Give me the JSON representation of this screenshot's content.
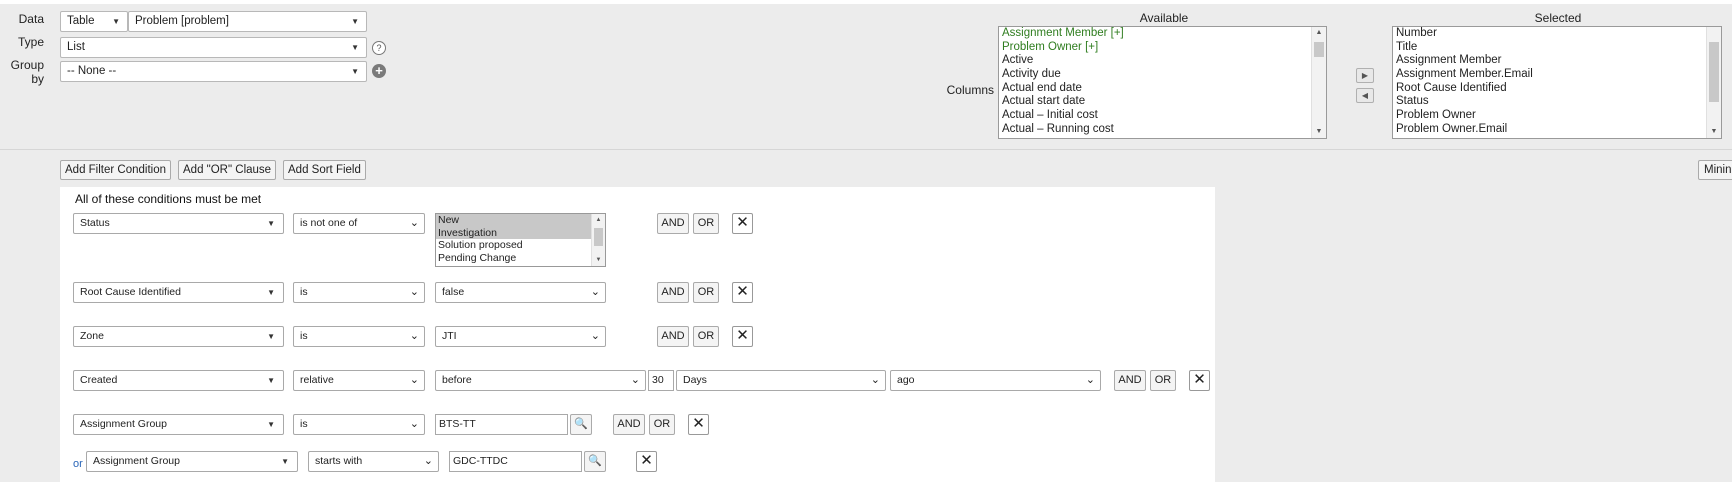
{
  "config": {
    "data_label": "Data",
    "type_label": "Type",
    "groupby_label": "Group by",
    "columns_label": "Columns",
    "data_source": "Table",
    "data_table": "Problem [problem]",
    "type_value": "List",
    "groupby_value": "-- None --",
    "help_icon": "?",
    "add_group_icon": "+"
  },
  "columns": {
    "available_header": "Available",
    "selected_header": "Selected",
    "available": [
      {
        "label": "Assignment Member [+]",
        "color": "#2f7d1f"
      },
      {
        "label": "Problem Owner [+]",
        "color": "#2f7d1f"
      },
      {
        "label": "Active"
      },
      {
        "label": "Activity due"
      },
      {
        "label": "Actual end date"
      },
      {
        "label": "Actual start date"
      },
      {
        "label": "Actual – Initial cost"
      },
      {
        "label": "Actual – Running cost"
      }
    ],
    "selected": [
      "Number",
      "Title",
      "Assignment Member",
      "Assignment Member.Email",
      "Root Cause Identified",
      "Status",
      "Problem Owner",
      "Problem Owner.Email"
    ],
    "move_right_icon": "▶",
    "move_left_icon": "◀"
  },
  "filter": {
    "add_filter_label": "Add Filter Condition",
    "add_or_label": "Add \"OR\" Clause",
    "add_sort_label": "Add Sort Field",
    "minimize_label": "Minin",
    "title": "All of these conditions must be met",
    "and_label": "AND",
    "or_label": "OR",
    "or_prefix": "or",
    "remove_icon": "✕",
    "search_icon": "🔍",
    "conditions": [
      {
        "field": "Status",
        "operator": "is not one of",
        "options": [
          "New",
          "Investigation",
          "Solution proposed",
          "Pending Change"
        ],
        "selected": [
          "New",
          "Investigation"
        ]
      },
      {
        "field": "Root Cause Identified",
        "operator": "is",
        "value": "false"
      },
      {
        "field": "Zone",
        "operator": "is",
        "value": "JTI"
      },
      {
        "field": "Created",
        "operator": "relative",
        "value": "before",
        "quantity": "30",
        "unit": "Days",
        "direction": "ago"
      },
      {
        "field": "Assignment Group",
        "operator": "is",
        "value": "BTS-TT"
      },
      {
        "field": "Assignment Group",
        "operator": "starts with",
        "value": "GDC-TTDC"
      }
    ]
  },
  "colors": {
    "panel_bg": "#ececec",
    "link_blue": "#2a66b8",
    "reference_green": "#2f7d1f"
  }
}
